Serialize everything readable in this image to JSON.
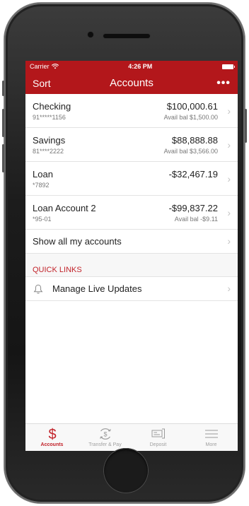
{
  "status": {
    "carrier": "Carrier",
    "time": "4:26 PM"
  },
  "nav": {
    "sort_label": "Sort",
    "title": "Accounts",
    "more_label": "•••"
  },
  "accounts": [
    {
      "name": "Checking",
      "number": "91*****1156",
      "balance": "$100,000.61",
      "avail": "Avail bal $1,500.00"
    },
    {
      "name": "Savings",
      "number": "81****2222",
      "balance": "$88,888.88",
      "avail": "Avail bal $3,566.00"
    },
    {
      "name": "Loan",
      "number": "*7892",
      "balance": "-$32,467.19",
      "avail": ""
    },
    {
      "name": "Loan Account 2",
      "number": "*95-01",
      "balance": "-$99,837.22",
      "avail": "Avail bal -$9.11"
    }
  ],
  "show_all_label": "Show all my accounts",
  "quick_links": {
    "header": "QUICK LINKS",
    "items": [
      {
        "label": "Manage Live Updates",
        "icon": "bell-icon"
      }
    ]
  },
  "tabs": [
    {
      "label": "Accounts",
      "icon": "dollar-icon",
      "active": true
    },
    {
      "label": "Transfer & Pay",
      "icon": "transfer-icon",
      "active": false
    },
    {
      "label": "Deposit",
      "icon": "check-deposit-icon",
      "active": false
    },
    {
      "label": "More",
      "icon": "menu-icon",
      "active": false
    }
  ],
  "colors": {
    "brand_red": "#b3171b",
    "accent_red": "#c2232a"
  },
  "chevron": "›"
}
